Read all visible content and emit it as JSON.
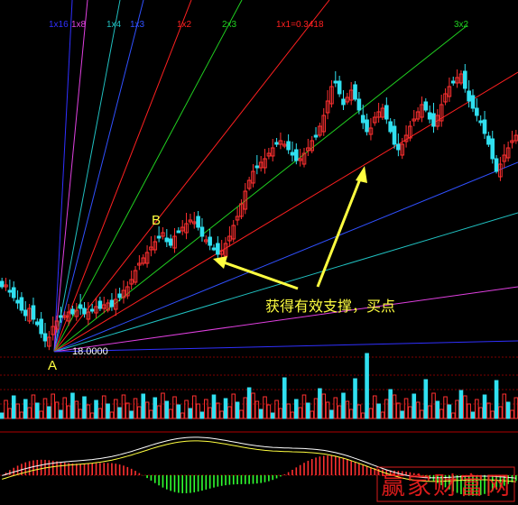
{
  "chart_data": {
    "type": "candlestick",
    "fan_lines": [
      {
        "label": "1x16",
        "color": "#3030ff"
      },
      {
        "label": "1x8",
        "color": "#e040e0"
      },
      {
        "label": "1x4",
        "color": "#20c0c0"
      },
      {
        "label": "1x3",
        "color": "#3050ff"
      },
      {
        "label": "1x2",
        "color": "#ff2020"
      },
      {
        "label": "2x3",
        "color": "#20d020"
      },
      {
        "label": "1x1=0.3418",
        "color": "#ff2020"
      },
      {
        "label": "3x2",
        "color": "#20d020"
      }
    ],
    "point_a": "A",
    "point_b": "B",
    "origin_price": "18.0000",
    "annotation": "获得有效支撑，买点",
    "watermark": "赢家财富网",
    "colors": {
      "up": "#ff3030",
      "down": "#30e0f0",
      "macd_line": "#ffffff",
      "signal_line": "#ffff40",
      "macd_pos": "#ff3030",
      "macd_neg": "#30ff30",
      "annotation": "#ffff40"
    }
  }
}
